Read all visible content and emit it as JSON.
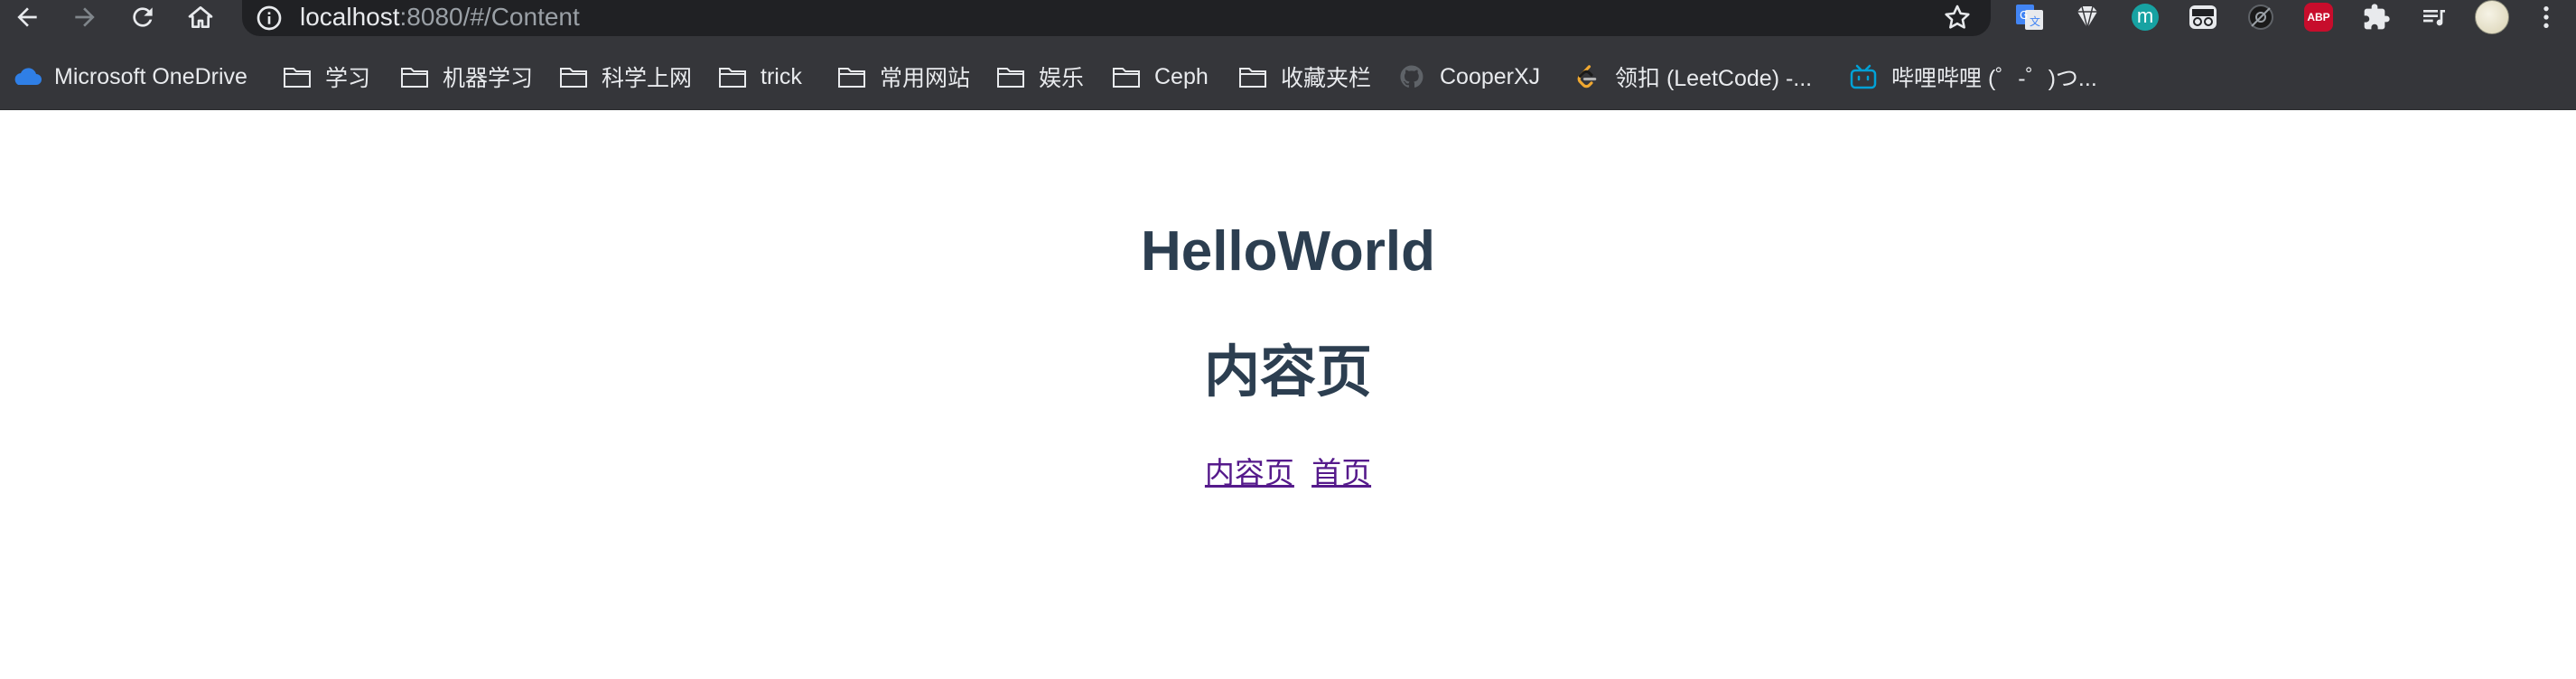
{
  "browser": {
    "url_host": "localhost",
    "url_path": ":8080/#/Content",
    "extensions": {
      "abp_label": "ABP",
      "m_label": "m"
    }
  },
  "bookmarks": [
    {
      "label": "Microsoft OneDrive",
      "icon": "onedrive-icon"
    },
    {
      "label": "学习",
      "icon": "folder-icon"
    },
    {
      "label": "机器学习",
      "icon": "folder-icon"
    },
    {
      "label": "科学上网",
      "icon": "folder-icon"
    },
    {
      "label": "trick",
      "icon": "folder-icon"
    },
    {
      "label": "常用网站",
      "icon": "folder-icon"
    },
    {
      "label": "娱乐",
      "icon": "folder-icon"
    },
    {
      "label": "Ceph",
      "icon": "folder-icon"
    },
    {
      "label": "收藏夹栏",
      "icon": "folder-icon"
    },
    {
      "label": "CooperXJ",
      "icon": "github-icon"
    },
    {
      "label": "领扣 (LeetCode) -...",
      "icon": "leetcode-icon"
    },
    {
      "label": "哔哩哔哩 (゜-゜)つ...",
      "icon": "bilibili-icon"
    }
  ],
  "page": {
    "heading": "HelloWorld",
    "subheading": "内容页",
    "links": [
      "内容页",
      "首页"
    ]
  },
  "colors": {
    "toolbar": "#35363a",
    "omnibox": "#202124",
    "heading": "#2c3e50",
    "visited_link": "#551a8b"
  }
}
